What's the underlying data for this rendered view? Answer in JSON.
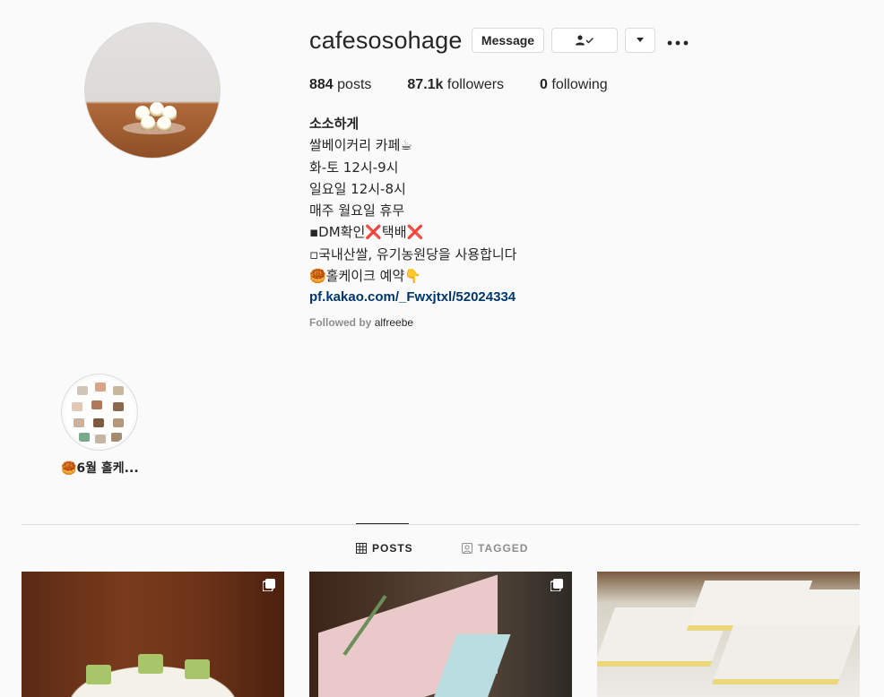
{
  "profile": {
    "username": "cafesosohage",
    "buttons": {
      "message": "Message"
    },
    "stats": {
      "posts_count": "884",
      "posts_label": "posts",
      "followers_count": "87.1k",
      "followers_label": "followers",
      "following_count": "0",
      "following_label": "following"
    },
    "bio": {
      "name": "소소하게",
      "lines": [
        "쌀베이커리 카페☕",
        "화-토 12시-9시",
        "일요일 12시-8시",
        "매주 월요일 휴무",
        "▪DM확인❌택배❌",
        "▫국내산쌀, 유기농원당을 사용합니다",
        "🥮홀케이크 예약👇"
      ],
      "link": "pf.kakao.com/_Fwxjtxl/52024334"
    },
    "followed_by": {
      "prefix": "Followed by",
      "user": "alfreebe"
    }
  },
  "highlights": [
    {
      "label": "🥮6월 홀케..."
    }
  ],
  "tabs": {
    "posts": "POSTS",
    "tagged": "TAGGED"
  },
  "icons": [
    "person-check-icon",
    "chevron-down-icon",
    "more-icon",
    "grid-icon",
    "tag-icon",
    "multi-post-icon"
  ]
}
